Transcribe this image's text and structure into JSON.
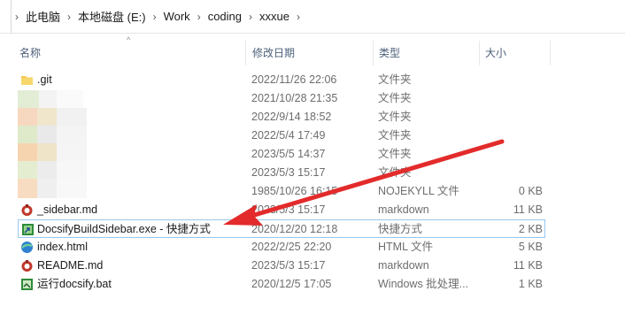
{
  "breadcrumb": {
    "items": [
      "此电脑",
      "本地磁盘 (E:)",
      "Work",
      "coding",
      "xxxue"
    ],
    "separator": "›"
  },
  "columns": {
    "name": "名称",
    "date": "修改日期",
    "type": "类型",
    "size": "大小"
  },
  "files": [
    {
      "name": ".git",
      "date": "2022/11/26 22:06",
      "type": "文件夹",
      "size": "",
      "icon": "folder-icon"
    },
    {
      "name": "",
      "date": "2021/10/28 21:35",
      "type": "文件夹",
      "size": "",
      "icon": "folder-icon"
    },
    {
      "name": "",
      "date": "2022/9/14 18:52",
      "type": "文件夹",
      "size": "",
      "icon": "folder-icon"
    },
    {
      "name": "",
      "date": "2022/5/4 17:49",
      "type": "文件夹",
      "size": "",
      "icon": "folder-icon"
    },
    {
      "name": "",
      "date": "2023/5/5 14:37",
      "type": "文件夹",
      "size": "",
      "icon": "folder-icon"
    },
    {
      "name": "",
      "date": "2023/5/3 15:17",
      "type": "文件夹",
      "size": "",
      "icon": "folder-icon"
    },
    {
      "name": "",
      "date": "1985/10/26 16:15",
      "type": "NOJEKYLL 文件",
      "size": "0 KB",
      "icon": "file-icon"
    },
    {
      "name": "_sidebar.md",
      "date": "2023/5/3 15:17",
      "type": "markdown",
      "size": "11 KB",
      "icon": "markdown-icon"
    },
    {
      "name": "DocsifyBuildSidebar.exe - 快捷方式",
      "date": "2020/12/20 12:18",
      "type": "快捷方式",
      "size": "2 KB",
      "icon": "shortcut-icon"
    },
    {
      "name": "index.html",
      "date": "2022/2/25 22:20",
      "type": "HTML 文件",
      "size": "5 KB",
      "icon": "html-icon"
    },
    {
      "name": "README.md",
      "date": "2023/5/3 15:17",
      "type": "markdown",
      "size": "11 KB",
      "icon": "markdown-icon"
    },
    {
      "name": "运行docsify.bat",
      "date": "2020/12/5 17:05",
      "type": "Windows 批处理...",
      "size": "1 KB",
      "icon": "batch-icon"
    }
  ],
  "colors": {
    "folder": "#f2c94c",
    "selection_border": "#99c8ef",
    "annotation_arrow": "#e32b2b",
    "header_text": "#4c607a"
  }
}
